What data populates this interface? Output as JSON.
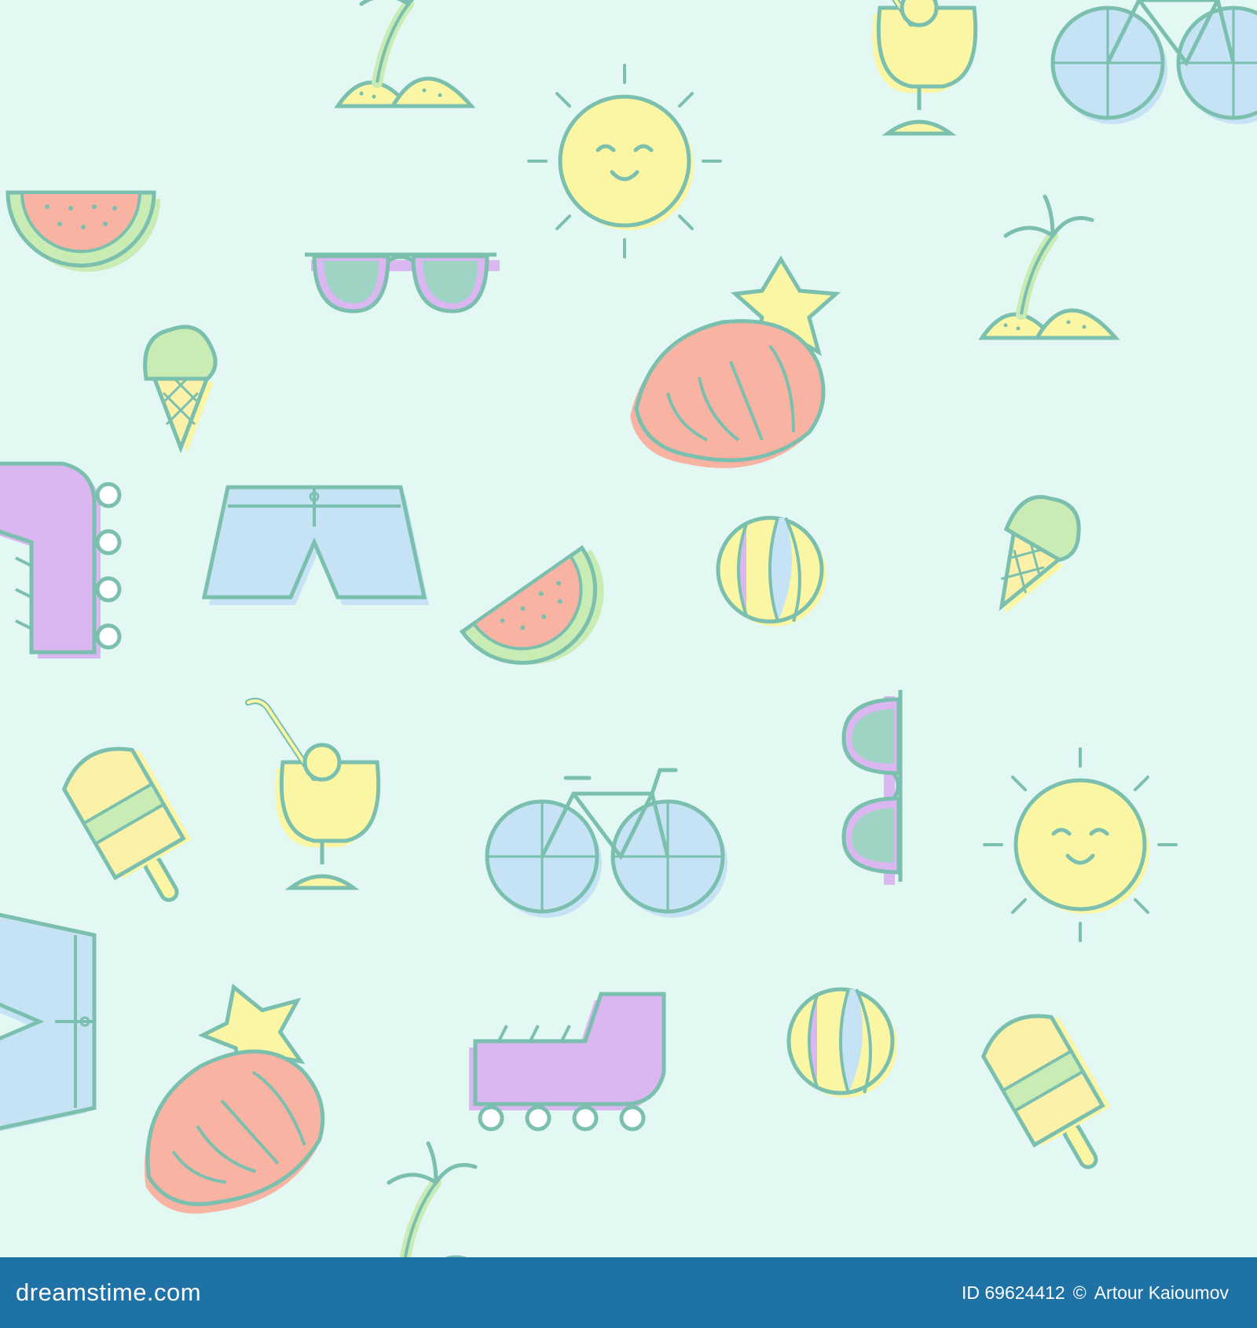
{
  "image": {
    "subject": "pastel seamless summer doodle pattern",
    "background_color": "#e3f8f3",
    "outline_color": "#7bbfae",
    "palette": {
      "yellow": "#fbf6a4",
      "pink": "#f8b3a3",
      "green": "#c9ebb4",
      "purple": "#dbb7f2",
      "blue": "#c6e3f6",
      "cream": "#fbf1a8"
    },
    "icons": [
      "sun-icon",
      "palm-island-icon",
      "watermelon-icon",
      "sunglasses-icon",
      "ice-cream-cone-icon",
      "seashell-icon",
      "starfish-icon",
      "shorts-icon",
      "beach-ball-icon",
      "roller-skate-icon",
      "cocktail-glass-icon",
      "popsicle-icon",
      "bicycle-icon"
    ]
  },
  "footer": {
    "background_color": "#1f72a6",
    "logo_text": "dreamstime.com",
    "id_label": "ID 69624412",
    "copyright_symbol": "©",
    "author": "Artour Kaioumov"
  }
}
